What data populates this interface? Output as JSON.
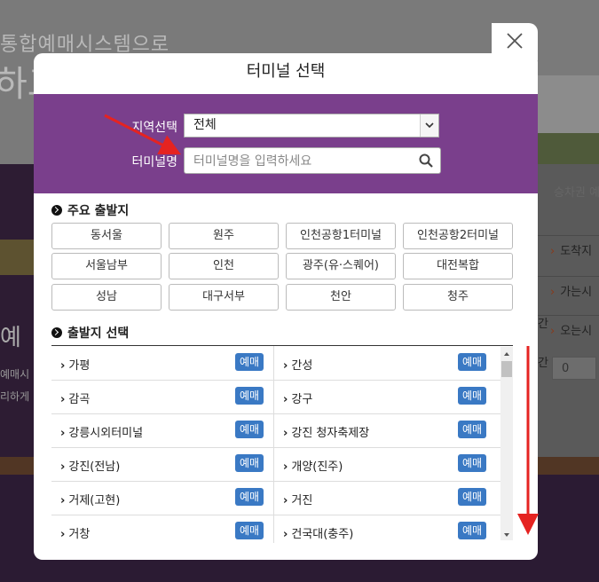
{
  "background": {
    "hero_line1": "통합예매시스템으로",
    "hero_line2": "하고",
    "left_big": "예",
    "left_small1": "예매시",
    "left_small2": "리하게",
    "right_tab": "승차권 예매",
    "right_rows": [
      "도착지",
      "가는시간",
      "오는시간"
    ],
    "right_select_value": "0"
  },
  "modal": {
    "title": "터미널 선택",
    "close_icon": "close-icon",
    "region_label": "지역선택",
    "region_value": "전체",
    "terminal_label": "터미널명",
    "terminal_placeholder": "터미널명을 입력하세요",
    "search_icon": "search-icon",
    "major_title": "주요 출발지",
    "major_departures": [
      "동서울",
      "원주",
      "인천공항1터미널",
      "인천공항2터미널",
      "서울남부",
      "인천",
      "광주(유·스퀘어)",
      "대전복합",
      "성남",
      "대구서부",
      "천안",
      "청주"
    ],
    "departure_title": "출발지 선택",
    "book_label": "예매",
    "departures": [
      [
        "가평",
        "간성"
      ],
      [
        "감곡",
        "강구"
      ],
      [
        "강릉시외터미널",
        "강진 청자축제장"
      ],
      [
        "강진(전남)",
        "개양(진주)"
      ],
      [
        "거제(고현)",
        "거진"
      ],
      [
        "거창",
        "건국대(충주)"
      ]
    ]
  },
  "colors": {
    "purple_band": "#7a3f8c",
    "book_button": "#3a79c4",
    "annotation_red": "#e52321"
  }
}
